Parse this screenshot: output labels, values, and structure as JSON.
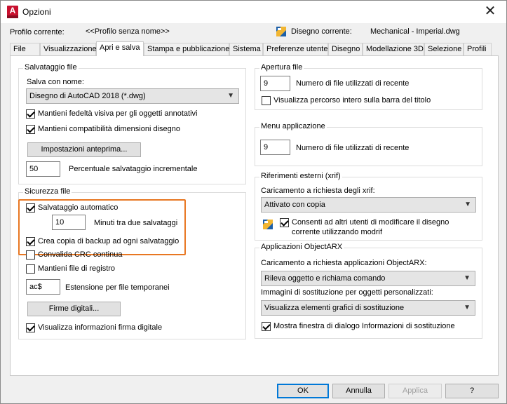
{
  "window": {
    "title": "Opzioni",
    "close_glyph": "✕"
  },
  "profile": {
    "current_label": "Profilo corrente:",
    "current_value": "<<Profilo senza nome>>",
    "drawing_label": "Disegno corrente:",
    "drawing_value": "Mechanical - Imperial.dwg"
  },
  "tabs": [
    "File",
    "Visualizzazione",
    "Apri e salva",
    "Stampa e pubblicazione",
    "Sistema",
    "Preferenze utente",
    "Disegno",
    "Modellazione 3D",
    "Selezione",
    "Profili"
  ],
  "save": {
    "group_title": "Salvataggio file",
    "save_as_label": "Salva con nome:",
    "save_as_value": "Disegno di AutoCAD 2018 (*.dwg)",
    "fidelity": "Mantieni fedeltà visiva per gli oggetti annotativi",
    "compat": "Mantieni compatibilità dimensioni disegno",
    "thumbnail_button": "Impostazioni anteprima...",
    "incremental_value": "50",
    "incremental_label": "Percentuale salvataggio incrementale"
  },
  "safety": {
    "group_title": "Sicurezza file",
    "autosave": "Salvataggio automatico",
    "minutes_value": "10",
    "minutes_label": "Minuti tra due salvataggi",
    "backup": "Crea copia di backup ad ogni salvataggio",
    "crc": "Convalida CRC continua",
    "log": "Mantieni file di registro",
    "temp_ext_value": "ac$",
    "temp_ext_label": "Estensione per file temporanei",
    "signatures_button": "Firme digitali...",
    "signature_info": "Visualizza informazioni firma digitale"
  },
  "open": {
    "group_title": "Apertura file",
    "recent_value": "9",
    "recent_label": "Numero di file utilizzati di recente",
    "full_path": "Visualizza percorso intero sulla barra del titolo"
  },
  "menu": {
    "group_title": "Menu applicazione",
    "recent_value": "9",
    "recent_label": "Numero di file utilizzati di recente"
  },
  "xref": {
    "group_title": "Riferimenti esterni (xrif)",
    "demand_label": "Caricamento a richiesta degli xrif:",
    "demand_value": "Attivato con copia",
    "allow_line1": "Consenti ad altri utenti di modificare il disegno",
    "allow_line2": "corrente utilizzando modrif"
  },
  "arx": {
    "group_title": "Applicazioni ObjectARX",
    "demand_label": "Caricamento a richiesta applicazioni ObjectARX:",
    "demand_value": "Rileva oggetto e richiama comando",
    "proxy_label": "Immagini di sostituzione per oggetti personalizzati:",
    "proxy_value": "Visualizza elementi grafici di sostituzione",
    "proxy_dialog": "Mostra finestra di dialogo Informazioni di sostituzione"
  },
  "footer": {
    "ok": "OK",
    "cancel": "Annulla",
    "apply": "Applica",
    "help": "?"
  },
  "colors": {
    "highlight": "#e87722",
    "focus": "#0078d7",
    "brand": "#c8102e"
  }
}
